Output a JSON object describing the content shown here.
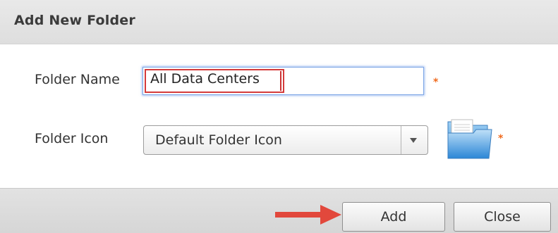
{
  "dialog": {
    "title": "Add New Folder"
  },
  "form": {
    "folder_name": {
      "label": "Folder Name",
      "value": "All Data Centers",
      "required_marker": "*"
    },
    "folder_icon": {
      "label": "Folder Icon",
      "selected": "Default Folder Icon",
      "required_marker": "*",
      "preview_icon": "folder-icon"
    }
  },
  "footer": {
    "add_label": "Add",
    "close_label": "Close",
    "annotation_icon": "red-arrow-icon"
  },
  "colors": {
    "required": "#f06a1d",
    "highlight_border": "#d43a3a",
    "focus_glow": "#5a8ce6",
    "annotation_arrow": "#e2483c"
  }
}
